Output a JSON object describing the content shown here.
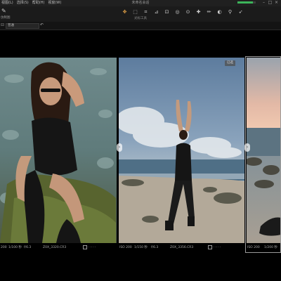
{
  "menubar": {
    "items": [
      "视图(L)",
      "选择(S)",
      "帮助(H)",
      "视窗(W)"
    ],
    "title": "未命名会话",
    "progress_fraction": 0.85
  },
  "toolbar": {
    "brush_label": "仿制图",
    "tools_label": "光标工具",
    "tool_icons": [
      "pan-icon",
      "select-icon",
      "crop-icon",
      "straighten-icon",
      "keystone-icon",
      "spot-icon",
      "clone-icon",
      "heal-icon",
      "brush-icon",
      "gradient-icon",
      "eyedropper-icon",
      "picker-icon"
    ]
  },
  "options": {
    "select_value": "普通"
  },
  "photos": [
    {
      "badge": "",
      "iso": "200",
      "shutter": "1/100 秒",
      "aperture": "f/6.3",
      "file": "Z0X_3320.CR3"
    },
    {
      "badge": "已选",
      "iso": "ISO 200",
      "shutter": "1/150 秒",
      "aperture": "f/6.3",
      "file": "Z0X_3356.CR3"
    },
    {
      "badge": "",
      "iso": "ISO 200",
      "shutter": "1/200 秒",
      "aperture": "",
      "file": ""
    }
  ],
  "colors": {
    "accent": "#e8a548",
    "progress": "#3cb45a",
    "background": "#000000"
  }
}
